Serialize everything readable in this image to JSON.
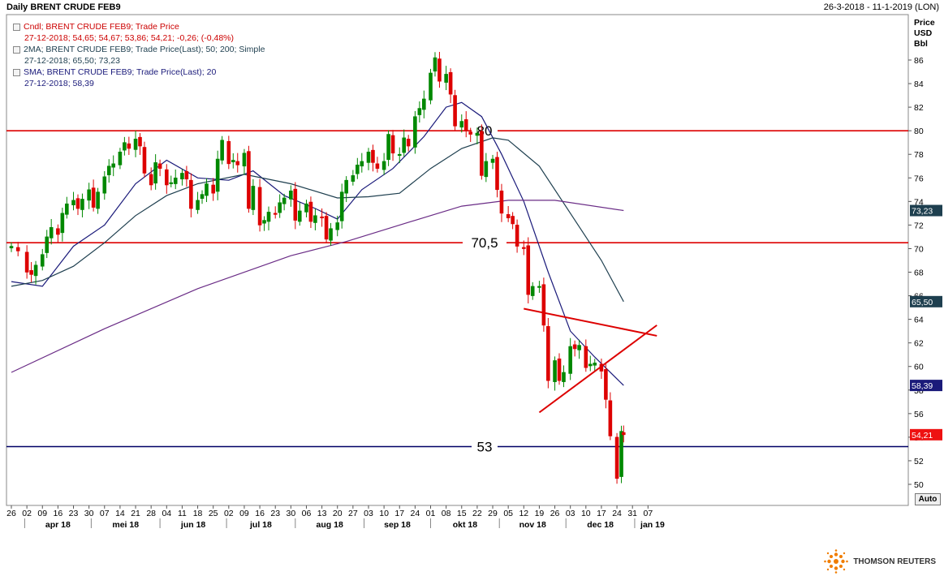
{
  "header": {
    "title": "Daily BRENT CRUDE FEB9",
    "date_range": "26-3-2018 - 11-1-2019 (LON)"
  },
  "legend": {
    "rows": [
      {
        "label": "Cndl; BRENT CRUDE FEB9; Trade Price",
        "values": "27-12-2018; 54,65; 54,67; 53,86; 54,21; -0,26; (-0,48%)",
        "color": "#cc0000"
      },
      {
        "label": "2MA; BRENT CRUDE FEB9; Trade Price(Last); 50; 200; Simple",
        "values": "27-12-2018; 65,50; 73,23",
        "color": "#1e3f4f"
      },
      {
        "label": "SMA; BRENT CRUDE FEB9; Trade Price(Last); 20",
        "values": "27-12-2018; 58,39",
        "color": "#1a1a7a"
      }
    ]
  },
  "axis": {
    "unit_lines": [
      "Price",
      "USD",
      "Bbl"
    ],
    "auto_label": "Auto",
    "y_ticks": [
      "50",
      "52",
      "54",
      "56",
      "58",
      "60",
      "62",
      "64",
      "66",
      "68",
      "70",
      "72",
      "74",
      "76",
      "78",
      "80",
      "82",
      "84",
      "86"
    ],
    "x_day_ticks": [
      "26",
      "02",
      "09",
      "16",
      "23",
      "30",
      "07",
      "14",
      "21",
      "28",
      "04",
      "11",
      "18",
      "25",
      "02",
      "09",
      "16",
      "23",
      "30",
      "06",
      "13",
      "20",
      "27",
      "03",
      "10",
      "17",
      "24",
      "01",
      "08",
      "15",
      "22",
      "29",
      "05",
      "12",
      "19",
      "26",
      "03",
      "10",
      "17",
      "24",
      "31",
      "07"
    ],
    "x_month_ticks": [
      "apr 18",
      "mei 18",
      "jun 18",
      "jul 18",
      "aug 18",
      "sep 18",
      "okt 18",
      "nov 18",
      "dec 18",
      "jan 19"
    ]
  },
  "footer": {
    "brand": "THOMSON REUTERS"
  },
  "chart_data": {
    "type": "candlestick",
    "ylim": [
      49,
      88
    ],
    "x_start": "2018-03-26",
    "x_end": "2019-01-11",
    "horizontal_levels": [
      {
        "label": "80",
        "value": 80,
        "color": "#dd0000"
      },
      {
        "label": "70,5",
        "value": 70.5,
        "color": "#dd0000"
      },
      {
        "label": "53",
        "value": 53.2,
        "color": "#000066"
      }
    ],
    "trend_lines": [
      {
        "from": [
          "2018-11-12",
          64.9
        ],
        "to": [
          "2019-01-11",
          62.6
        ],
        "color": "#dd0000"
      },
      {
        "from": [
          "2018-11-19",
          56.1
        ],
        "to": [
          "2019-01-11",
          63.5
        ],
        "color": "#dd0000"
      }
    ],
    "value_tags": [
      {
        "label": "73,23",
        "value": 73.23,
        "bg": "#1e3f4f",
        "fg": "#ffffff"
      },
      {
        "label": "65,50",
        "value": 65.5,
        "bg": "#1e3f4f",
        "fg": "#ffffff"
      },
      {
        "label": "58,39",
        "value": 58.39,
        "bg": "#1a1a7a",
        "fg": "#ffffff"
      },
      {
        "label": "54,21",
        "value": 54.21,
        "bg": "#ee1111",
        "fg": "#ffffff"
      }
    ],
    "candles": [
      {
        "date": "2018-03-26",
        "close": 70.2
      },
      {
        "date": "2018-03-29",
        "close": 69.8
      },
      {
        "date": "2018-04-02",
        "close": 68.0
      },
      {
        "date": "2018-04-04",
        "close": 67.8
      },
      {
        "date": "2018-04-06",
        "close": 68.6
      },
      {
        "date": "2018-04-09",
        "close": 69.5
      },
      {
        "date": "2018-04-11",
        "close": 71.0
      },
      {
        "date": "2018-04-13",
        "close": 71.8
      },
      {
        "date": "2018-04-16",
        "close": 71.2
      },
      {
        "date": "2018-04-18",
        "close": 73.0
      },
      {
        "date": "2018-04-20",
        "close": 73.8
      },
      {
        "date": "2018-04-23",
        "close": 74.1
      },
      {
        "date": "2018-04-25",
        "close": 73.4
      },
      {
        "date": "2018-04-27",
        "close": 74.2
      },
      {
        "date": "2018-04-30",
        "close": 75.0
      },
      {
        "date": "2018-05-02",
        "close": 73.5
      },
      {
        "date": "2018-05-04",
        "close": 74.8
      },
      {
        "date": "2018-05-07",
        "close": 76.1
      },
      {
        "date": "2018-05-09",
        "close": 77.0
      },
      {
        "date": "2018-05-11",
        "close": 77.2
      },
      {
        "date": "2018-05-14",
        "close": 78.2
      },
      {
        "date": "2018-05-16",
        "close": 79.0
      },
      {
        "date": "2018-05-18",
        "close": 78.5
      },
      {
        "date": "2018-05-21",
        "close": 79.3
      },
      {
        "date": "2018-05-23",
        "close": 78.7
      },
      {
        "date": "2018-05-25",
        "close": 76.4
      },
      {
        "date": "2018-05-28",
        "close": 75.4
      },
      {
        "date": "2018-05-30",
        "close": 77.3
      },
      {
        "date": "2018-06-01",
        "close": 76.8
      },
      {
        "date": "2018-06-04",
        "close": 75.4
      },
      {
        "date": "2018-06-06",
        "close": 75.6
      },
      {
        "date": "2018-06-08",
        "close": 76.0
      },
      {
        "date": "2018-06-11",
        "close": 76.4
      },
      {
        "date": "2018-06-13",
        "close": 75.9
      },
      {
        "date": "2018-06-15",
        "close": 73.4
      },
      {
        "date": "2018-06-18",
        "close": 74.1
      },
      {
        "date": "2018-06-20",
        "close": 74.6
      },
      {
        "date": "2018-06-22",
        "close": 75.5
      },
      {
        "date": "2018-06-25",
        "close": 74.7
      },
      {
        "date": "2018-06-27",
        "close": 77.6
      },
      {
        "date": "2018-06-29",
        "close": 79.2
      },
      {
        "date": "2018-07-02",
        "close": 77.2
      },
      {
        "date": "2018-07-04",
        "close": 77.5
      },
      {
        "date": "2018-07-06",
        "close": 77.1
      },
      {
        "date": "2018-07-09",
        "close": 78.1
      },
      {
        "date": "2018-07-11",
        "close": 73.4
      },
      {
        "date": "2018-07-13",
        "close": 75.3
      },
      {
        "date": "2018-07-16",
        "close": 72.0
      },
      {
        "date": "2018-07-18",
        "close": 72.4
      },
      {
        "date": "2018-07-20",
        "close": 73.1
      },
      {
        "date": "2018-07-23",
        "close": 72.9
      },
      {
        "date": "2018-07-25",
        "close": 73.9
      },
      {
        "date": "2018-07-27",
        "close": 74.3
      },
      {
        "date": "2018-07-30",
        "close": 74.9
      },
      {
        "date": "2018-08-01",
        "close": 72.4
      },
      {
        "date": "2018-08-03",
        "close": 73.2
      },
      {
        "date": "2018-08-06",
        "close": 73.8
      },
      {
        "date": "2018-08-08",
        "close": 72.3
      },
      {
        "date": "2018-08-10",
        "close": 72.8
      },
      {
        "date": "2018-08-13",
        "close": 72.6
      },
      {
        "date": "2018-08-15",
        "close": 70.8
      },
      {
        "date": "2018-08-17",
        "close": 71.7
      },
      {
        "date": "2018-08-20",
        "close": 72.2
      },
      {
        "date": "2018-08-22",
        "close": 74.8
      },
      {
        "date": "2018-08-24",
        "close": 75.8
      },
      {
        "date": "2018-08-27",
        "close": 76.2
      },
      {
        "date": "2018-08-29",
        "close": 77.1
      },
      {
        "date": "2018-08-31",
        "close": 77.4
      },
      {
        "date": "2018-09-03",
        "close": 78.2
      },
      {
        "date": "2018-09-05",
        "close": 77.3
      },
      {
        "date": "2018-09-07",
        "close": 76.8
      },
      {
        "date": "2018-09-10",
        "close": 77.4
      },
      {
        "date": "2018-09-12",
        "close": 79.7
      },
      {
        "date": "2018-09-14",
        "close": 78.1
      },
      {
        "date": "2018-09-17",
        "close": 78.0
      },
      {
        "date": "2018-09-19",
        "close": 79.4
      },
      {
        "date": "2018-09-21",
        "close": 78.7
      },
      {
        "date": "2018-09-24",
        "close": 81.2
      },
      {
        "date": "2018-09-26",
        "close": 81.9
      },
      {
        "date": "2018-09-28",
        "close": 82.7
      },
      {
        "date": "2018-10-01",
        "close": 84.9
      },
      {
        "date": "2018-10-03",
        "close": 86.2
      },
      {
        "date": "2018-10-05",
        "close": 84.2
      },
      {
        "date": "2018-10-08",
        "close": 84.8
      },
      {
        "date": "2018-10-10",
        "close": 83.1
      },
      {
        "date": "2018-10-12",
        "close": 80.4
      },
      {
        "date": "2018-10-15",
        "close": 80.8
      },
      {
        "date": "2018-10-17",
        "close": 80.0
      },
      {
        "date": "2018-10-19",
        "close": 79.7
      },
      {
        "date": "2018-10-22",
        "close": 79.8
      },
      {
        "date": "2018-10-24",
        "close": 76.2
      },
      {
        "date": "2018-10-26",
        "close": 77.4
      },
      {
        "date": "2018-10-29",
        "close": 77.6
      },
      {
        "date": "2018-10-31",
        "close": 75.0
      },
      {
        "date": "2018-11-02",
        "close": 73.0
      },
      {
        "date": "2018-11-05",
        "close": 72.6
      },
      {
        "date": "2018-11-07",
        "close": 72.1
      },
      {
        "date": "2018-11-09",
        "close": 70.2
      },
      {
        "date": "2018-11-12",
        "close": 70.1
      },
      {
        "date": "2018-11-14",
        "close": 66.1
      },
      {
        "date": "2018-11-16",
        "close": 66.8
      },
      {
        "date": "2018-11-19",
        "close": 66.8
      },
      {
        "date": "2018-11-21",
        "close": 63.5
      },
      {
        "date": "2018-11-23",
        "close": 58.8
      },
      {
        "date": "2018-11-26",
        "close": 60.5
      },
      {
        "date": "2018-11-28",
        "close": 58.8
      },
      {
        "date": "2018-11-30",
        "close": 59.5
      },
      {
        "date": "2018-12-03",
        "close": 61.7
      },
      {
        "date": "2018-12-05",
        "close": 61.5
      },
      {
        "date": "2018-12-07",
        "close": 61.8
      },
      {
        "date": "2018-12-10",
        "close": 59.9
      },
      {
        "date": "2018-12-12",
        "close": 60.2
      },
      {
        "date": "2018-12-14",
        "close": 60.3
      },
      {
        "date": "2018-12-17",
        "close": 59.6
      },
      {
        "date": "2018-12-19",
        "close": 57.2
      },
      {
        "date": "2018-12-21",
        "close": 54.1
      },
      {
        "date": "2018-12-24",
        "close": 50.5
      },
      {
        "date": "2018-12-26",
        "close": 54.5
      },
      {
        "date": "2018-12-27",
        "close": 54.21
      }
    ],
    "series": [
      {
        "name": "SMA 20",
        "color": "#1a1a7a",
        "points": [
          [
            "2018-03-26",
            67.2
          ],
          [
            "2018-04-09",
            66.8
          ],
          [
            "2018-04-23",
            70.2
          ],
          [
            "2018-05-07",
            72.0
          ],
          [
            "2018-05-21",
            75.5
          ],
          [
            "2018-06-04",
            77.5
          ],
          [
            "2018-06-18",
            76.0
          ],
          [
            "2018-07-02",
            75.8
          ],
          [
            "2018-07-13",
            76.6
          ],
          [
            "2018-07-27",
            74.5
          ],
          [
            "2018-08-10",
            73.4
          ],
          [
            "2018-08-20",
            72.5
          ],
          [
            "2018-08-31",
            75.0
          ],
          [
            "2018-09-14",
            76.8
          ],
          [
            "2018-09-28",
            79.5
          ],
          [
            "2018-10-08",
            82.0
          ],
          [
            "2018-10-15",
            82.4
          ],
          [
            "2018-10-24",
            81.2
          ],
          [
            "2018-11-02",
            78.0
          ],
          [
            "2018-11-12",
            74.0
          ],
          [
            "2018-11-23",
            68.0
          ],
          [
            "2018-12-03",
            63.0
          ],
          [
            "2018-12-14",
            60.8
          ],
          [
            "2018-12-27",
            58.39
          ]
        ]
      },
      {
        "name": "MA 50",
        "color": "#1e3f4f",
        "points": [
          [
            "2018-03-26",
            66.8
          ],
          [
            "2018-04-09",
            67.3
          ],
          [
            "2018-04-23",
            68.5
          ],
          [
            "2018-05-07",
            70.5
          ],
          [
            "2018-05-21",
            72.8
          ],
          [
            "2018-06-04",
            74.5
          ],
          [
            "2018-06-18",
            75.5
          ],
          [
            "2018-07-09",
            76.3
          ],
          [
            "2018-07-30",
            75.5
          ],
          [
            "2018-08-20",
            74.3
          ],
          [
            "2018-09-03",
            74.4
          ],
          [
            "2018-09-17",
            74.7
          ],
          [
            "2018-10-01",
            76.8
          ],
          [
            "2018-10-15",
            78.5
          ],
          [
            "2018-10-29",
            79.4
          ],
          [
            "2018-11-05",
            79.2
          ],
          [
            "2018-11-19",
            77.0
          ],
          [
            "2018-12-03",
            73.0
          ],
          [
            "2018-12-17",
            69.0
          ],
          [
            "2018-12-27",
            65.5
          ]
        ]
      },
      {
        "name": "MA 200",
        "color": "#6a2c86",
        "points": [
          [
            "2018-03-26",
            59.5
          ],
          [
            "2018-05-07",
            63.2
          ],
          [
            "2018-06-18",
            66.6
          ],
          [
            "2018-07-30",
            69.4
          ],
          [
            "2018-08-24",
            70.6
          ],
          [
            "2018-09-17",
            72.0
          ],
          [
            "2018-10-15",
            73.6
          ],
          [
            "2018-11-05",
            74.1
          ],
          [
            "2018-11-26",
            74.1
          ],
          [
            "2018-12-27",
            73.23
          ]
        ]
      }
    ]
  }
}
